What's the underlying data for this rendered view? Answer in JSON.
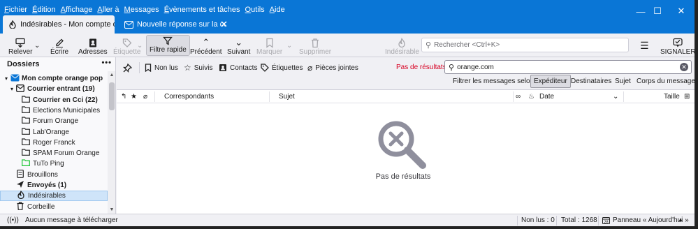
{
  "menu": [
    "Fichier",
    "Édition",
    "Affichage",
    "Aller à",
    "Messages",
    "Évènements et tâches",
    "Outils",
    "Aide"
  ],
  "window_controls": {
    "minimize": "—",
    "maximize": "☐",
    "close": "✕"
  },
  "tabs": [
    {
      "title": "Indésirables - Mon compte orange pop"
    },
    {
      "title": "Nouvelle réponse sur la communauté"
    }
  ],
  "toolbar": {
    "relever": "Relever",
    "ecrire": "Écrire",
    "adresses": "Adresses",
    "etiquette": "Étiquette",
    "filtre_rapide": "Filtre rapide",
    "precedent": "Précédent",
    "suivant": "Suivant",
    "marquer": "Marquer",
    "supprimer": "Supprimer",
    "indesirable": "Indésirable",
    "signaler": "SIGNALER",
    "search_placeholder": "Rechercher <Ctrl+K>"
  },
  "folders": {
    "header": "Dossiers",
    "items": [
      {
        "label": "Mon compte orange pop",
        "level": 0,
        "bold": true,
        "icon": "account-icon",
        "twisty": "▾"
      },
      {
        "label": "Courrier entrant (19)",
        "level": 1,
        "bold": true,
        "icon": "inbox-icon",
        "twisty": "▾"
      },
      {
        "label": "Courrier en Cci (22)",
        "level": 2,
        "bold": true,
        "icon": "folder-icon",
        "twisty": ""
      },
      {
        "label": "Elections Municipales",
        "level": 2,
        "bold": false,
        "icon": "folder-icon",
        "twisty": ""
      },
      {
        "label": "Forum Orange",
        "level": 2,
        "bold": false,
        "icon": "folder-icon",
        "twisty": ""
      },
      {
        "label": "Lab'Orange",
        "level": 2,
        "bold": false,
        "icon": "folder-icon",
        "twisty": ""
      },
      {
        "label": "Roger Franck",
        "level": 2,
        "bold": false,
        "icon": "folder-icon",
        "twisty": ""
      },
      {
        "label": "SPAM Forum Orange",
        "level": 2,
        "bold": false,
        "icon": "folder-icon",
        "twisty": ""
      },
      {
        "label": "TuTo Ping",
        "level": 2,
        "bold": false,
        "icon": "folder-green-icon",
        "twisty": ""
      },
      {
        "label": "Brouillons",
        "level": 1,
        "bold": false,
        "icon": "drafts-icon",
        "twisty": ""
      },
      {
        "label": "Envoyés (1)",
        "level": 1,
        "bold": true,
        "icon": "sent-icon",
        "twisty": ""
      },
      {
        "label": "Indésirables",
        "level": 1,
        "bold": false,
        "icon": "junk-icon",
        "twisty": "",
        "selected": true
      },
      {
        "label": "Corbeille",
        "level": 1,
        "bold": false,
        "icon": "trash-icon",
        "twisty": ""
      }
    ]
  },
  "quickfilter": {
    "non_lus": "Non lus",
    "suivis": "Suivis",
    "contacts": "Contacts",
    "etiquettes": "Étiquettes",
    "pieces_jointes": "Pièces jointes",
    "no_results": "Pas de résultats",
    "search_value": "orange.com",
    "filter_by_label": "Filtrer les messages selon :",
    "filter_buttons": [
      {
        "label": "Expéditeur",
        "active": true
      },
      {
        "label": "Destinataires",
        "active": false
      },
      {
        "label": "Sujet",
        "active": false
      },
      {
        "label": "Corps du message",
        "active": false
      }
    ]
  },
  "columns": {
    "correspondants": "Correspondants",
    "sujet": "Sujet",
    "date": "Date",
    "taille": "Taille"
  },
  "empty_state": "Pas de résultats",
  "status": {
    "message": "Aucun message à télécharger",
    "non_lus": "Non lus : 0",
    "total": "Total : 1268",
    "panneau": "Panneau « Aujourd'hui »"
  },
  "colors": {
    "accent": "#0a76d6",
    "selection": "#cfe4f9",
    "no_results": "#d70022"
  }
}
